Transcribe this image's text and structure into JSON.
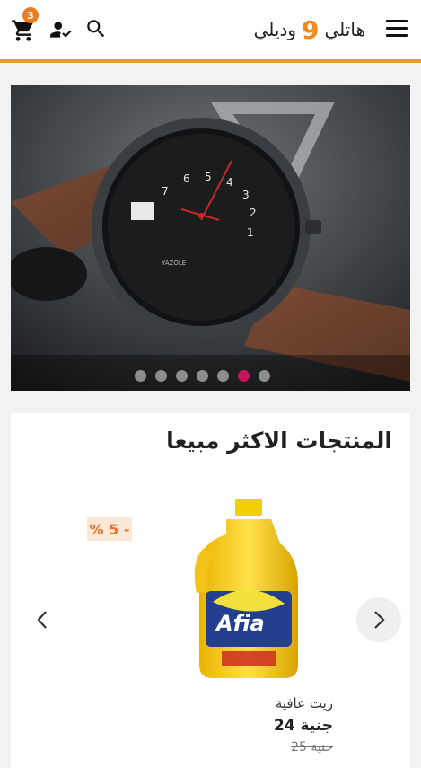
{
  "header": {
    "brand_word1": "هاتلي",
    "brand_number": "9",
    "brand_word2": "وديلي",
    "cart_count": "3",
    "icons": [
      "cart-icon",
      "account-check-icon",
      "search-icon",
      "menu-icon"
    ],
    "accent_color": "#e8963a"
  },
  "banner": {
    "slide_count": 7,
    "active_slide": 6,
    "watch_brand": "YAZOLE"
  },
  "best_sellers": {
    "title": "المنتجات الاكثر مبيعا",
    "product": {
      "name": "زيت عافية",
      "price": "جنية 24",
      "old_price": "جنية 25",
      "discount": "% 5 -",
      "label_text": "Afia"
    }
  }
}
